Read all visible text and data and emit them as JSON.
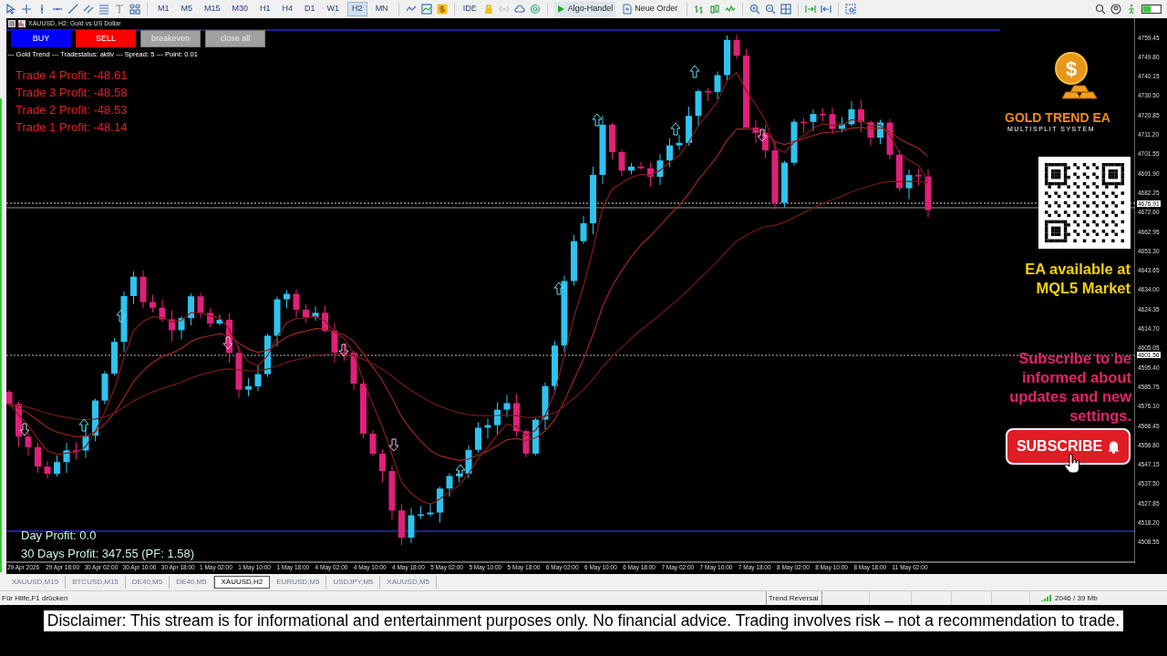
{
  "toolbar": {
    "timeframes": [
      {
        "label": "M1",
        "selected": false
      },
      {
        "label": "M5",
        "selected": false
      },
      {
        "label": "M15",
        "selected": false
      },
      {
        "label": "M30",
        "selected": false
      },
      {
        "label": "H1",
        "selected": false
      },
      {
        "label": "H4",
        "selected": false
      },
      {
        "label": "D1",
        "selected": false
      },
      {
        "label": "W1",
        "selected": false
      },
      {
        "label": "H2",
        "selected": true
      },
      {
        "label": "MN",
        "selected": false
      }
    ],
    "ide_label": "IDE",
    "algo_button": "Algo-Handel",
    "order_button": "Neue Order"
  },
  "chart": {
    "title": "XAUUSD, H2: Gold vs US Dollar",
    "trade_buttons": [
      {
        "label": "BUY",
        "kind": "buy"
      },
      {
        "label": "SELL",
        "kind": "sell"
      },
      {
        "label": "breakeven",
        "kind": "neutral"
      },
      {
        "label": "close all",
        "kind": "neutral"
      }
    ],
    "status_line": "--- Gold Trend --- Tradestatus: aktiv --- Spread: 5 --- Point: 0.01",
    "trade_profits": [
      "Trade 4 Profit: -48.61",
      "Trade 3 Profit: -48.58",
      "Trade 2 Profit: -48.53",
      "Trade 1 Profit: -48.14"
    ],
    "day_profit": "Day Profit: 0.0",
    "period_profit": "30 Days Profit: 347.55 (PF: 1.58)",
    "price_labels": [
      {
        "text": "4759.45",
        "kind": "tick"
      },
      {
        "text": "4749.80",
        "kind": "tick"
      },
      {
        "text": "4740.15",
        "kind": "tick"
      },
      {
        "text": "4730.50",
        "kind": "tick"
      },
      {
        "text": "4720.85",
        "kind": "tick"
      },
      {
        "text": "4711.20",
        "kind": "tick"
      },
      {
        "text": "4701.55",
        "kind": "tick"
      },
      {
        "text": "4691.90",
        "kind": "tick"
      },
      {
        "text": "4682.25",
        "kind": "tick"
      },
      {
        "text": "4676.91",
        "kind": "current"
      },
      {
        "text": "4672.60",
        "kind": "tick"
      },
      {
        "text": "4662.95",
        "kind": "tick"
      },
      {
        "text": "4653.30",
        "kind": "tick"
      },
      {
        "text": "4643.65",
        "kind": "tick"
      },
      {
        "text": "4634.00",
        "kind": "tick"
      },
      {
        "text": "4624.35",
        "kind": "tick"
      },
      {
        "text": "4614.70",
        "kind": "tick"
      },
      {
        "text": "4605.05",
        "kind": "tick"
      },
      {
        "text": "4601.56",
        "kind": "current"
      },
      {
        "text": "4595.40",
        "kind": "tick"
      },
      {
        "text": "4585.75",
        "kind": "tick"
      },
      {
        "text": "4576.10",
        "kind": "tick"
      },
      {
        "text": "4566.45",
        "kind": "tick"
      },
      {
        "text": "4556.80",
        "kind": "tick"
      },
      {
        "text": "4547.15",
        "kind": "tick"
      },
      {
        "text": "4537.50",
        "kind": "tick"
      },
      {
        "text": "4527.85",
        "kind": "tick"
      },
      {
        "text": "4518.20",
        "kind": "tick"
      },
      {
        "text": "4508.55",
        "kind": "tick"
      }
    ],
    "time_labels": [
      "29 Apr 2026",
      "29 Apr 18:00",
      "30 Apr 02:00",
      "30 Apr 10:00",
      "30 Apr 18:00",
      "1 May 02:00",
      "1 May 10:00",
      "1 May 18:00",
      "4 May 02:00",
      "4 May 10:00",
      "4 May 18:00",
      "5 May 02:00",
      "5 May 10:00",
      "5 May 18:00",
      "6 May 02:00",
      "6 May 10:00",
      "6 May 18:00",
      "7 May 02:00",
      "7 May 10:00",
      "7 May 18:00",
      "8 May 02:00",
      "8 May 10:00",
      "8 May 18:00",
      "11 May 02:00"
    ]
  },
  "overlay": {
    "logo_symbol": "$",
    "brand": "GOLD TREND EA",
    "tagline": "MULTISPLIT SYSTEM",
    "availability": "EA available at MQL5 Market",
    "subscribe_text": "Subscribe to be informed about updates and new settings.",
    "subscribe_button": "SUBSCRIBE"
  },
  "tabs": [
    {
      "label": "XAUUSD,M15",
      "selected": false
    },
    {
      "label": "BTCUSD,M15",
      "selected": false
    },
    {
      "label": "DE40,M5",
      "selected": false
    },
    {
      "label": "DE40,M5",
      "selected": false
    },
    {
      "label": "XAUUSD,H2",
      "selected": true
    },
    {
      "label": "EURUSD,M5",
      "selected": false
    },
    {
      "label": "USDJPY,M5",
      "selected": false
    },
    {
      "label": "XAUUSD,M5",
      "selected": false
    }
  ],
  "status_bar": {
    "help": "Für Hilfe,F1 drücken",
    "indicator": "Trend Reversal",
    "memory": "2046 / 39 Mb"
  },
  "disclaimer": "Disclaimer: This stream is for informational and entertainment purposes only. No financial advice. Trading involves risk – not a recommendation to trade."
}
